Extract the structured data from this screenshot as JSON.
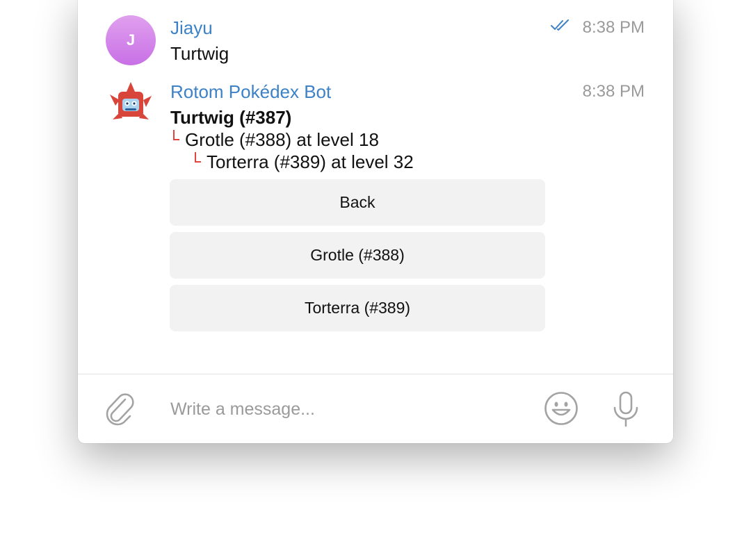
{
  "messages": [
    {
      "avatar_initial": "J",
      "sender": "Jiayu",
      "time": "8:38 PM",
      "status_icon": "double-check-icon",
      "text": "Turtwig"
    },
    {
      "avatar_icon": "rotom-pokedex-icon",
      "sender": "Rotom Pokédex Bot",
      "time": "8:38 PM",
      "title": "Turtwig (#387)",
      "evolution": [
        {
          "text": "Grotle (#388) at level 18"
        },
        {
          "text": "Torterra (#389) at level 32"
        }
      ],
      "buttons": [
        {
          "label": "Back"
        },
        {
          "label": "Grotle (#388)"
        },
        {
          "label": "Torterra (#389)"
        }
      ]
    }
  ],
  "composer": {
    "placeholder": "Write a message...",
    "attach_icon": "paperclip-icon",
    "emoji_icon": "smiley-icon",
    "mic_icon": "microphone-icon"
  },
  "colors": {
    "link_blue": "#3d82c6",
    "evolution_mark": "#e0443c",
    "avatar_purple": "#cc78e8",
    "button_bg": "#f2f2f2"
  }
}
